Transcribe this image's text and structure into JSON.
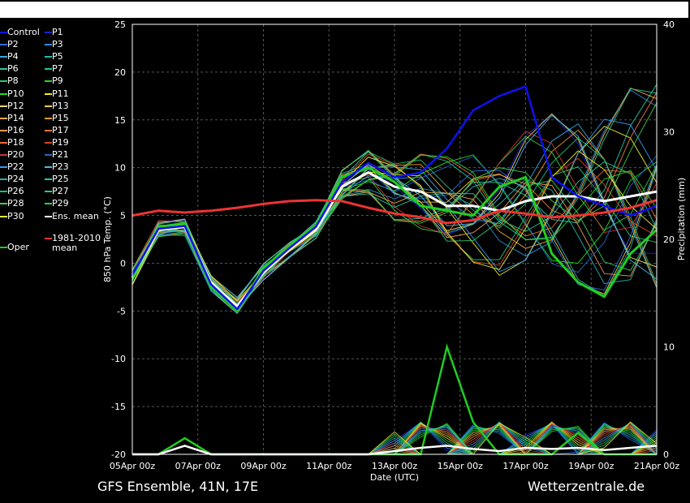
{
  "chart_data": {
    "type": "line",
    "x": [
      "05Apr 00z",
      "07Apr 00z",
      "09Apr 00z",
      "11Apr 00z",
      "13Apr 00z",
      "15Apr 00z",
      "17Apr 00z",
      "19Apr 00z",
      "21Apr 00z"
    ],
    "xlabel": "Date (UTC)",
    "ylabel": "850 hPa Temp. (°C)",
    "ylabel_right": "Precipitation (mm)",
    "ylim": [
      -20,
      25
    ],
    "ylim_right": [
      0,
      40
    ],
    "yticks": [
      "25",
      "20",
      "15",
      "10",
      "5",
      "0",
      "-5",
      "-10",
      "-15",
      "-20"
    ],
    "yticks_right": [
      "40",
      "30",
      "20",
      "10",
      "0"
    ],
    "grid": true,
    "series": [
      {
        "name": "Ens. mean",
        "color": "#ffffff",
        "values": [
          -1.5,
          3.5,
          3.8,
          -2,
          -4.5,
          -1,
          1.5,
          3.5,
          8,
          9.5,
          8,
          7.5,
          6,
          6,
          5.5,
          6.5,
          7,
          7,
          6.5,
          7,
          7.5
        ]
      },
      {
        "name": "Oper",
        "color": "#22cc22",
        "values": [
          -1.5,
          3.8,
          4.2,
          -2.5,
          -5,
          -0.5,
          1.8,
          4,
          9,
          10,
          8.5,
          6,
          5.5,
          5,
          8,
          9,
          1,
          -2,
          -3.5,
          1,
          3.5
        ]
      },
      {
        "name": "Control",
        "color": "#1010ee",
        "values": [
          -1.2,
          3.6,
          3.9,
          -2.2,
          -4.8,
          -0.8,
          1.6,
          3.8,
          8.5,
          10.5,
          9,
          9.5,
          12,
          16,
          17.5,
          18.5,
          9,
          7,
          6,
          5,
          6
        ]
      },
      {
        "name": "1981-2010 mean",
        "color": "#ee3333",
        "values": [
          5,
          5.5,
          5.3,
          5.5,
          5.8,
          6.2,
          6.5,
          6.6,
          6.5,
          5.8,
          5.2,
          4.8,
          4.2,
          4.5,
          5.5,
          5.2,
          4.8,
          5,
          5.3,
          5.8,
          6.6
        ]
      }
    ],
    "precip_series": [
      {
        "name": "Oper",
        "color": "#22cc22",
        "values": [
          0,
          0,
          1.5,
          0,
          0,
          0,
          0,
          0,
          0,
          0,
          0,
          0,
          10,
          3,
          0,
          0,
          0,
          2,
          0,
          0,
          0
        ]
      },
      {
        "name": "Ens. mean",
        "color": "#ffffff",
        "values": [
          0,
          0,
          0.8,
          0,
          0,
          0,
          0,
          0,
          0,
          0,
          0.3,
          0.6,
          0.8,
          0.5,
          0.3,
          0.6,
          0.5,
          0.6,
          0.4,
          0.6,
          0.8
        ]
      }
    ],
    "legend": [
      {
        "label": "Control",
        "color": "#1010ee"
      },
      {
        "label": "P1",
        "color": "#2020dd"
      },
      {
        "label": "P2",
        "color": "#2a6fdc"
      },
      {
        "label": "P3",
        "color": "#2a8fe0"
      },
      {
        "label": "P4",
        "color": "#30a6e6"
      },
      {
        "label": "P5",
        "color": "#20b8b8"
      },
      {
        "label": "P6",
        "color": "#25c8a8"
      },
      {
        "label": "P7",
        "color": "#20c890"
      },
      {
        "label": "P8",
        "color": "#28c878"
      },
      {
        "label": "P9",
        "color": "#30d040"
      },
      {
        "label": "P10",
        "color": "#22dd22"
      },
      {
        "label": "P11",
        "color": "#eeee22"
      },
      {
        "label": "P12",
        "color": "#eedd66"
      },
      {
        "label": "P13",
        "color": "#eecc44"
      },
      {
        "label": "P14",
        "color": "#eeaa44"
      },
      {
        "label": "P15",
        "color": "#ee9922"
      },
      {
        "label": "P16",
        "color": "#ee9955"
      },
      {
        "label": "P17",
        "color": "#ee7744"
      },
      {
        "label": "P18",
        "color": "#ee6633"
      },
      {
        "label": "P19",
        "color": "#dd4422"
      },
      {
        "label": "P20",
        "color": "#cc3333"
      },
      {
        "label": "P21",
        "color": "#2266cc"
      },
      {
        "label": "P22",
        "color": "#3399ee"
      },
      {
        "label": "P23",
        "color": "#44bbee"
      },
      {
        "label": "P24",
        "color": "#33aaaa"
      },
      {
        "label": "P25",
        "color": "#22cc99"
      },
      {
        "label": "P26",
        "color": "#22bb77"
      },
      {
        "label": "P27",
        "color": "#33cc66"
      },
      {
        "label": "P28",
        "color": "#44cc44"
      },
      {
        "label": "P29",
        "color": "#22dd22"
      },
      {
        "label": "P30",
        "color": "#eeee33"
      },
      {
        "label": "Ens. mean",
        "color": "#ffffff"
      },
      {
        "label": "1981-2010 mean",
        "color": "#ee3333"
      },
      {
        "label": "Oper",
        "color": "#22cc22"
      }
    ]
  },
  "footer": {
    "left": "GFS Ensemble, 41N, 17E",
    "right": "Wetterzentrale.de"
  }
}
